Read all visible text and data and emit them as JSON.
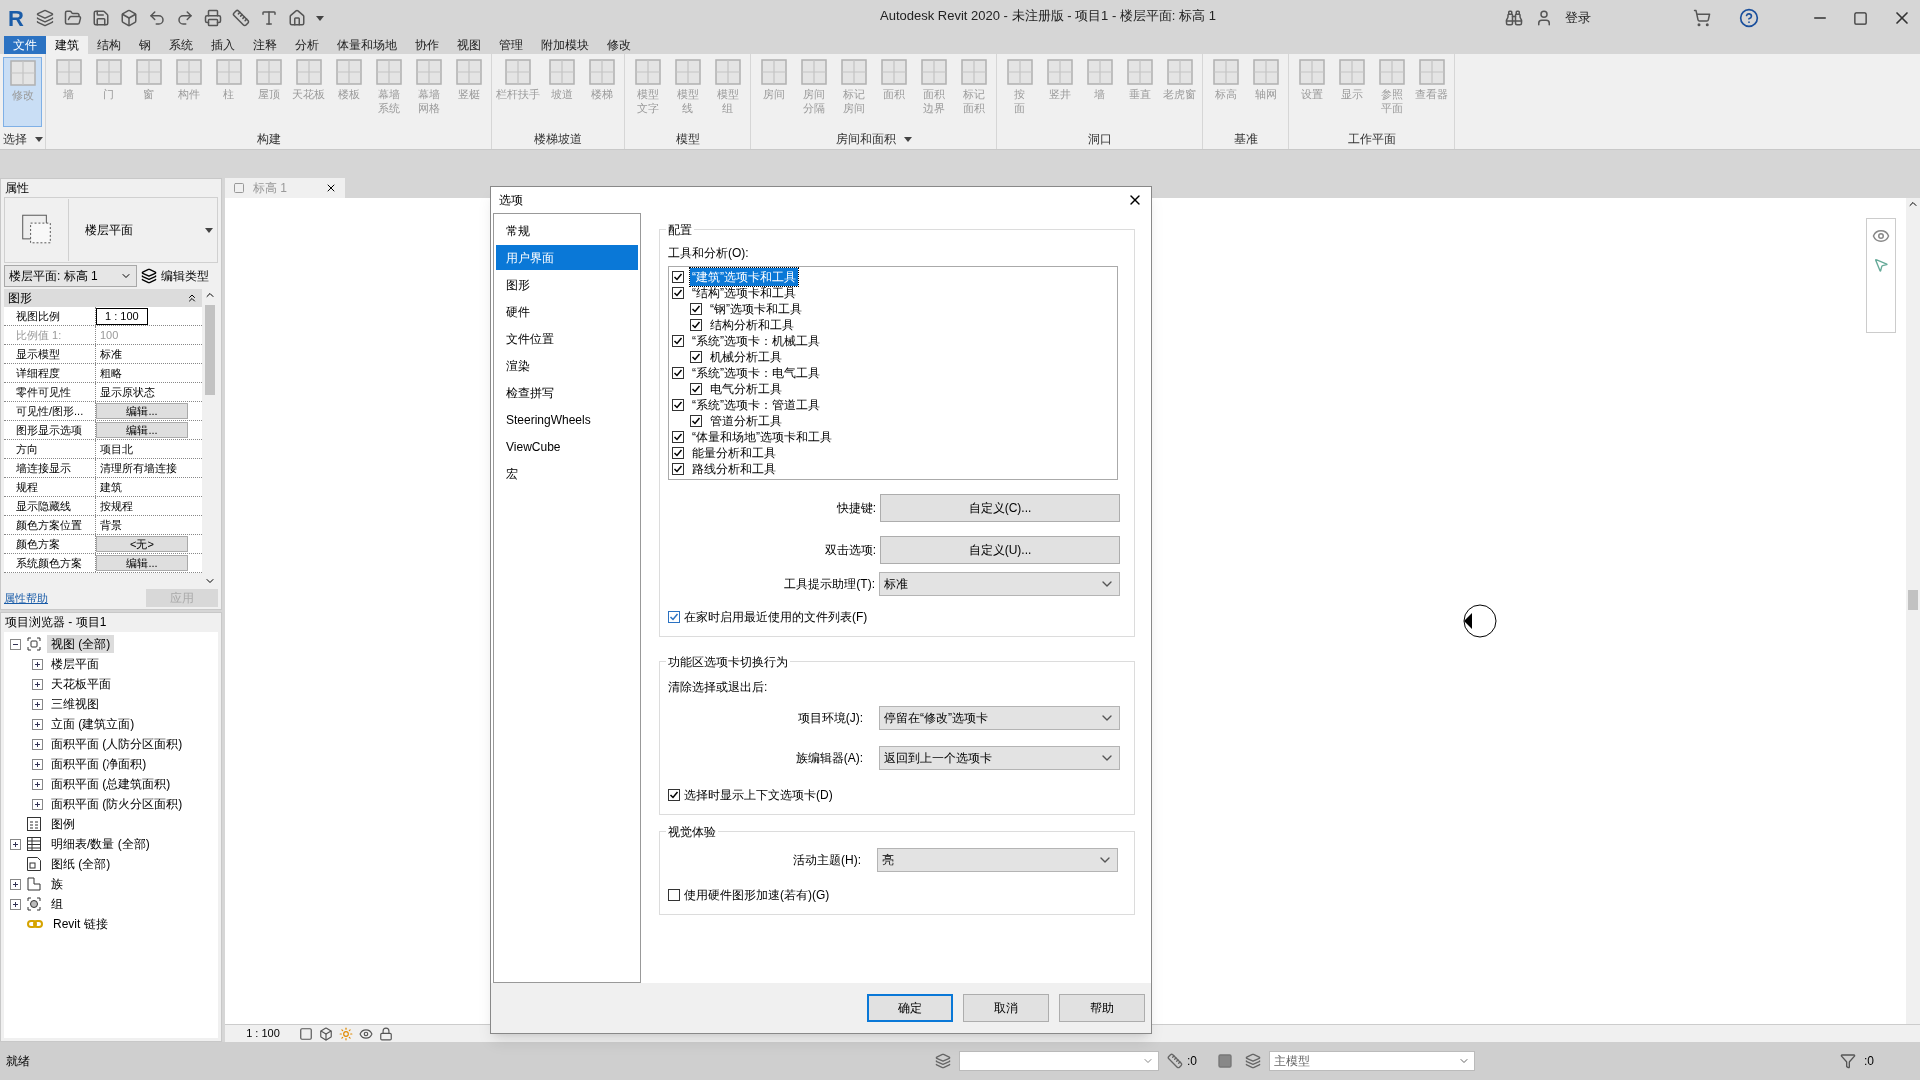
{
  "window": {
    "logo": "R",
    "title": "Autodesk Revit 2020 - 未注册版 - 项目1 - 楼层平面: 标高 1",
    "sign_in": "登录"
  },
  "ribbon_tabs": [
    {
      "label": "文件",
      "kind": "file",
      "selected": false
    },
    {
      "label": "建筑",
      "kind": "tab",
      "selected": true
    },
    {
      "label": "结构",
      "kind": "tab",
      "selected": false
    },
    {
      "label": "钢",
      "kind": "tab",
      "selected": false
    },
    {
      "label": "系统",
      "kind": "tab",
      "selected": false
    },
    {
      "label": "插入",
      "kind": "tab",
      "selected": false
    },
    {
      "label": "注释",
      "kind": "tab",
      "selected": false
    },
    {
      "label": "分析",
      "kind": "tab",
      "selected": false
    },
    {
      "label": "体量和场地",
      "kind": "tab",
      "selected": false
    },
    {
      "label": "协作",
      "kind": "tab",
      "selected": false
    },
    {
      "label": "视图",
      "kind": "tab",
      "selected": false
    },
    {
      "label": "管理",
      "kind": "tab",
      "selected": false
    },
    {
      "label": "附加模块",
      "kind": "tab",
      "selected": false
    },
    {
      "label": "修改",
      "kind": "tab",
      "selected": false
    }
  ],
  "ribbon_panels": [
    {
      "label": "选择",
      "menu": true,
      "buttons": [
        {
          "lines": [
            "修改"
          ],
          "selected": true
        }
      ]
    },
    {
      "label": "构建",
      "menu": false,
      "buttons": [
        {
          "lines": [
            "墙"
          ],
          "selected": false
        },
        {
          "lines": [
            "门"
          ],
          "selected": false
        },
        {
          "lines": [
            "窗"
          ],
          "selected": false
        },
        {
          "lines": [
            "构件"
          ],
          "selected": false
        },
        {
          "lines": [
            "柱"
          ],
          "selected": false
        },
        {
          "lines": [
            "屋顶"
          ],
          "selected": false
        },
        {
          "lines": [
            "天花板"
          ],
          "selected": false
        },
        {
          "lines": [
            "楼板"
          ],
          "selected": false
        },
        {
          "lines": [
            "幕墙",
            "系统"
          ],
          "selected": false
        },
        {
          "lines": [
            "幕墙",
            "网格"
          ],
          "selected": false
        },
        {
          "lines": [
            "竖梃"
          ],
          "selected": false
        }
      ]
    },
    {
      "label": "楼梯坡道",
      "menu": false,
      "buttons": [
        {
          "lines": [
            "栏杆扶手"
          ],
          "selected": false
        },
        {
          "lines": [
            "坡道"
          ],
          "selected": false
        },
        {
          "lines": [
            "楼梯"
          ],
          "selected": false
        }
      ]
    },
    {
      "label": "模型",
      "menu": false,
      "buttons": [
        {
          "lines": [
            "模型",
            "文字"
          ],
          "selected": false
        },
        {
          "lines": [
            "模型",
            "线"
          ],
          "selected": false
        },
        {
          "lines": [
            "模型",
            "组"
          ],
          "selected": false
        }
      ]
    },
    {
      "label": "房间和面积",
      "menu": true,
      "buttons": [
        {
          "lines": [
            "房间"
          ],
          "selected": false
        },
        {
          "lines": [
            "房间",
            "分隔"
          ],
          "selected": false
        },
        {
          "lines": [
            "标记",
            "房间"
          ],
          "selected": false
        },
        {
          "lines": [
            "面积"
          ],
          "selected": false
        },
        {
          "lines": [
            "面积",
            "边界"
          ],
          "selected": false
        },
        {
          "lines": [
            "标记",
            "面积"
          ],
          "selected": false
        }
      ]
    },
    {
      "label": "洞口",
      "menu": false,
      "buttons": [
        {
          "lines": [
            "按",
            "面"
          ],
          "selected": false
        },
        {
          "lines": [
            "竖井"
          ],
          "selected": false
        },
        {
          "lines": [
            "墙"
          ],
          "selected": false
        },
        {
          "lines": [
            "垂直"
          ],
          "selected": false
        },
        {
          "lines": [
            "老虎窗"
          ],
          "selected": false
        }
      ]
    },
    {
      "label": "基准",
      "menu": false,
      "buttons": [
        {
          "lines": [
            "标高"
          ],
          "selected": false
        },
        {
          "lines": [
            "轴网"
          ],
          "selected": false
        }
      ]
    },
    {
      "label": "工作平面",
      "menu": false,
      "buttons": [
        {
          "lines": [
            "设置"
          ],
          "selected": false
        },
        {
          "lines": [
            "显示"
          ],
          "selected": false
        },
        {
          "lines": [
            "参照",
            "平面"
          ],
          "selected": false
        },
        {
          "lines": [
            "查看器"
          ],
          "selected": false
        }
      ]
    }
  ],
  "properties": {
    "title": "属性",
    "type_name": "楼层平面",
    "instance": "楼层平面: 标高 1",
    "edit_type": "编辑类型",
    "group": "图形",
    "rows": [
      {
        "name": "视图比例",
        "value": "1 : 100",
        "kind": "field"
      },
      {
        "name": "比例值 1:",
        "value": "100",
        "kind": "readonly"
      },
      {
        "name": "显示模型",
        "value": "标准",
        "kind": "text"
      },
      {
        "name": "详细程度",
        "value": "粗略",
        "kind": "text"
      },
      {
        "name": "零件可见性",
        "value": "显示原状态",
        "kind": "text"
      },
      {
        "name": "可见性/图形...",
        "value": "编辑...",
        "kind": "button"
      },
      {
        "name": "图形显示选项",
        "value": "编辑...",
        "kind": "button"
      },
      {
        "name": "方向",
        "value": "项目北",
        "kind": "text"
      },
      {
        "name": "墙连接显示",
        "value": "清理所有墙连接",
        "kind": "text"
      },
      {
        "name": "规程",
        "value": "建筑",
        "kind": "text"
      },
      {
        "name": "显示隐藏线",
        "value": "按规程",
        "kind": "text"
      },
      {
        "name": "颜色方案位置",
        "value": "背景",
        "kind": "text"
      },
      {
        "name": "颜色方案",
        "value": "<无>",
        "kind": "button"
      },
      {
        "name": "系统颜色方案",
        "value": "编辑...",
        "kind": "button"
      }
    ],
    "help": "属性帮助",
    "apply": "应用"
  },
  "project_browser": {
    "title": "项目浏览器 - 项目1",
    "tree": [
      {
        "label": "视图 (全部)",
        "kind": "views",
        "expanded": true,
        "selected": true,
        "children": [
          {
            "label": "楼层平面",
            "expanded": false,
            "selected": false
          },
          {
            "label": "天花板平面",
            "expanded": false,
            "selected": false
          },
          {
            "label": "三维视图",
            "expanded": false,
            "selected": false
          },
          {
            "label": "立面 (建筑立面)",
            "expanded": false,
            "selected": false
          },
          {
            "label": "面积平面 (人防分区面积)",
            "expanded": false,
            "selected": false
          },
          {
            "label": "面积平面 (净面积)",
            "expanded": false,
            "selected": false
          },
          {
            "label": "面积平面 (总建筑面积)",
            "expanded": false,
            "selected": false
          },
          {
            "label": "面积平面 (防火分区面积)",
            "expanded": false,
            "selected": false
          }
        ]
      },
      {
        "label": "图例",
        "kind": "legend",
        "selected": false
      },
      {
        "label": "明细表/数量 (全部)",
        "kind": "schedule",
        "expanded": false,
        "selected": false
      },
      {
        "label": "图纸 (全部)",
        "kind": "sheet",
        "selected": false
      },
      {
        "label": "族",
        "kind": "family",
        "expanded": false,
        "selected": false
      },
      {
        "label": "组",
        "kind": "group",
        "expanded": false,
        "selected": false
      },
      {
        "label": "Revit 链接",
        "kind": "link",
        "selected": false
      }
    ]
  },
  "view": {
    "tab": "标高 1",
    "scale": "1 : 100"
  },
  "options_dialog": {
    "title": "选项",
    "nav": [
      {
        "label": "常规",
        "selected": false
      },
      {
        "label": "用户界面",
        "selected": true
      },
      {
        "label": "图形",
        "selected": false
      },
      {
        "label": "硬件",
        "selected": false
      },
      {
        "label": "文件位置",
        "selected": false
      },
      {
        "label": "渲染",
        "selected": false
      },
      {
        "label": "检查拼写",
        "selected": false
      },
      {
        "label": "SteeringWheels",
        "selected": false
      },
      {
        "label": "ViewCube",
        "selected": false
      },
      {
        "label": "宏",
        "selected": false
      }
    ],
    "config": {
      "title": "配置",
      "tools_label": "工具和分析(O):",
      "tools": [
        {
          "label": "“建筑”选项卡和工具",
          "checked": true,
          "selected": true
        },
        {
          "label": "“结构”选项卡和工具",
          "checked": true,
          "selected": false,
          "children": [
            {
              "label": "“钢”选项卡和工具",
              "checked": true,
              "selected": false
            },
            {
              "label": "结构分析和工具",
              "checked": true,
              "selected": false
            }
          ]
        },
        {
          "label": "“系统”选项卡：机械工具",
          "checked": true,
          "selected": false,
          "children": [
            {
              "label": "机械分析工具",
              "checked": true,
              "selected": false
            }
          ]
        },
        {
          "label": "“系统”选项卡：电气工具",
          "checked": true,
          "selected": false,
          "children": [
            {
              "label": "电气分析工具",
              "checked": true,
              "selected": false
            }
          ]
        },
        {
          "label": "“系统”选项卡：管道工具",
          "checked": true,
          "selected": false,
          "children": [
            {
              "label": "管道分析工具",
              "checked": true,
              "selected": false
            }
          ]
        },
        {
          "label": "“体量和场地”选项卡和工具",
          "checked": true,
          "selected": false
        },
        {
          "label": "能量分析和工具",
          "checked": true,
          "selected": false
        },
        {
          "label": "路线分析和工具",
          "checked": true,
          "selected": false
        }
      ],
      "shortcuts_label": "快捷键:",
      "shortcuts_button": "自定义(C)...",
      "double_click_label": "双击选项:",
      "double_click_button": "自定义(U)...",
      "tooltip_label": "工具提示助理(T):",
      "tooltip_value": "标准",
      "recent_files": {
        "label": "在家时启用最近使用的文件列表(F)",
        "checked": true
      }
    },
    "tab_switch": {
      "title": "功能区选项卡切换行为",
      "subtitle": "清除选择或退出后:",
      "project_label": "项目环境(J):",
      "project_value": "停留在“修改”选项卡",
      "family_label": "族编辑器(A):",
      "family_value": "返回到上一个选项卡",
      "contextual": {
        "label": "选择时显示上下文选项卡(D)",
        "checked": true
      }
    },
    "visual": {
      "title": "视觉体验",
      "theme_label": "活动主题(H):",
      "theme_value": "亮",
      "hardware": {
        "label": "使用硬件图形加速(若有)(G)",
        "checked": false
      }
    },
    "buttons": [
      "确定",
      "取消",
      "帮助"
    ]
  },
  "status_bar": {
    "message": "就绪",
    "count": ":0",
    "model": "主模型",
    "filter_count": ":0"
  }
}
